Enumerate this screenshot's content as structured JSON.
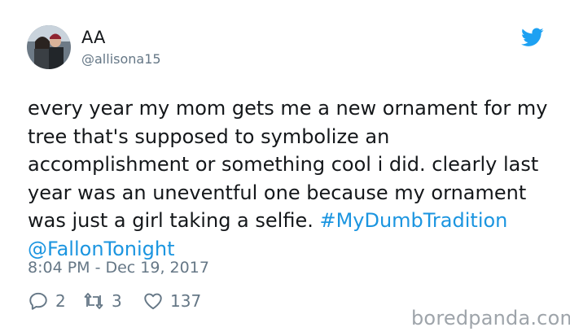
{
  "user": {
    "display_name": "AA",
    "handle": "@allisona15"
  },
  "tweet": {
    "text_main": "every year my mom gets me a new ornament for my tree that's supposed to symbolize an accomplishment or something cool i did. clearly last year was an uneventful one because my ornament was just a girl taking a selfie. ",
    "hashtag": "#MyDumbTradition",
    "mention": "@FallonTonight",
    "timestamp": "8:04 PM - Dec 19, 2017"
  },
  "actions": {
    "replies": "2",
    "retweets": "3",
    "likes": "137"
  },
  "watermark": "boredpanda.com",
  "icons": {
    "brand": "twitter-bird-icon",
    "reply": "reply-icon",
    "retweet": "retweet-icon",
    "like": "heart-icon"
  },
  "colors": {
    "text": "#14171a",
    "secondary": "#657786",
    "link": "#1b95e0",
    "brand": "#1da1f2"
  }
}
